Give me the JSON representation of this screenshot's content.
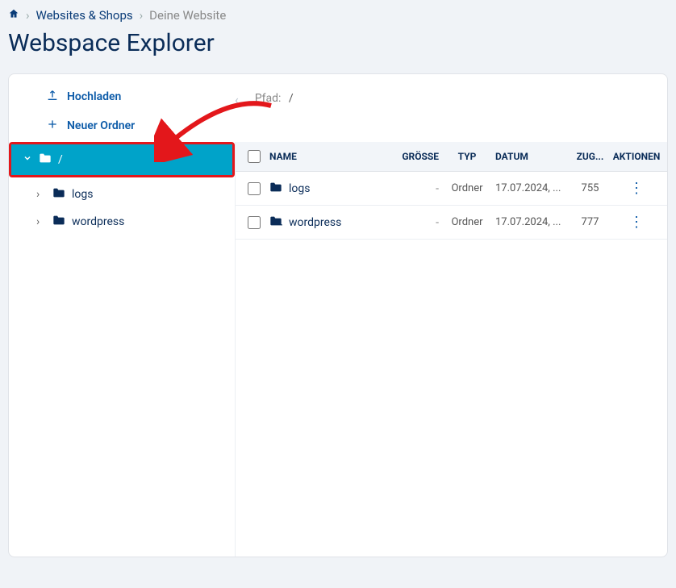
{
  "breadcrumb": {
    "item1": "Websites & Shops",
    "item2": "Deine Website"
  },
  "page_title": "Webspace Explorer",
  "toolbar": {
    "upload_label": "Hochladen",
    "new_folder_label": "Neuer Ordner",
    "path_label": "Pfad:",
    "path_value": "/"
  },
  "tree": {
    "root_label": "/",
    "items": [
      {
        "label": "logs"
      },
      {
        "label": "wordpress"
      }
    ]
  },
  "table": {
    "headers": {
      "name": "NAME",
      "size": "GRÖSSE",
      "type": "TYP",
      "date": "DATUM",
      "perm": "ZUG...",
      "actions": "AKTIONEN"
    },
    "rows": [
      {
        "name": "logs",
        "size": "-",
        "type": "Ordner",
        "date": "17.07.2024, ...",
        "perm": "755"
      },
      {
        "name": "wordpress",
        "size": "-",
        "type": "Ordner",
        "date": "17.07.2024, ...",
        "perm": "777"
      }
    ]
  }
}
